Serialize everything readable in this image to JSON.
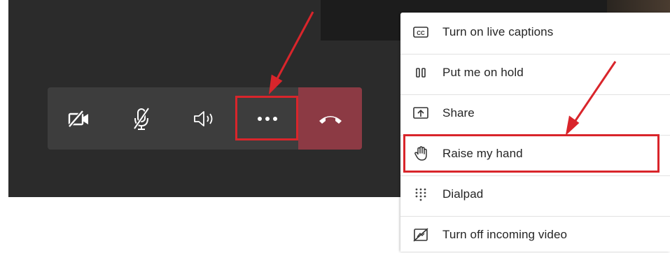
{
  "call_controls": {
    "camera": {
      "icon": "camera-off-icon",
      "interactable": true
    },
    "mic": {
      "icon": "mic-off-icon",
      "interactable": true
    },
    "speaker": {
      "icon": "speaker-icon",
      "interactable": true
    },
    "more": {
      "icon": "more-options-icon",
      "label": "..."
    },
    "hangup": {
      "icon": "hang-up-icon",
      "color": "#8c3a44"
    }
  },
  "menu": {
    "items": [
      {
        "icon": "closed-captions-icon",
        "label": "Turn on live captions"
      },
      {
        "icon": "pause-icon",
        "label": "Put me on hold"
      },
      {
        "icon": "share-screen-icon",
        "label": "Share"
      },
      {
        "icon": "raise-hand-icon",
        "label": "Raise my hand"
      },
      {
        "icon": "dialpad-icon",
        "label": "Dialpad"
      },
      {
        "icon": "video-off-icon",
        "label": "Turn off incoming video"
      }
    ]
  },
  "colors": {
    "annotation_red": "#d9252b",
    "meeting_background": "#2b2b2b",
    "control_bar": "#3d3d3d"
  }
}
